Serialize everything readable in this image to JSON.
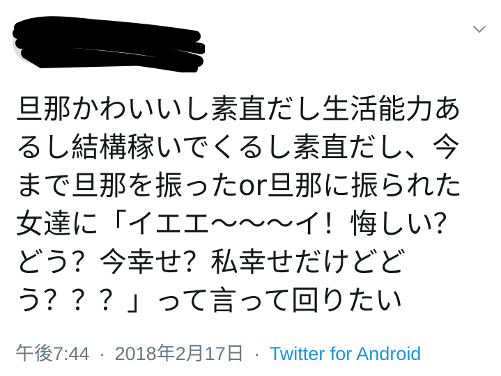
{
  "tweet": {
    "avatar_icon": "user-avatar",
    "author_redacted": true,
    "menu_icon": "chevron-down-icon",
    "text_lines": [
      "旦那かわいいし素直だし生活能力あ",
      "るし結構稼いでくるし素直だし、今",
      "まで旦那を振ったor旦那に振られた",
      "女達に「イエエ〜〜〜イ！悔しい？",
      "どう？今幸せ？私幸せだけどど",
      "う？？？」って言って回りたい"
    ],
    "time": "午後7:44",
    "separator_1": "·",
    "date": "2018年2月17日",
    "separator_2": "·",
    "source": "Twitter for Android"
  },
  "colors": {
    "text": "#14171a",
    "meta": "#657786",
    "link": "#1b95e0",
    "redaction": "#000000"
  }
}
